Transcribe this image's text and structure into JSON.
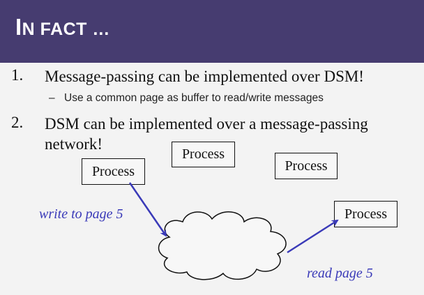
{
  "slide": {
    "title_first": "I",
    "title_rest": "N FACT …",
    "items": [
      {
        "number": "1.",
        "text": "Message-passing can be implemented over DSM!",
        "sub_dash": "–",
        "sub": "Use a common page as buffer to read/write messages"
      },
      {
        "number": "2.",
        "text": "DSM can be implemented over a message-passing network!"
      }
    ],
    "diagram": {
      "processes": [
        "Process",
        "Process",
        "Process",
        "Process"
      ],
      "write_label": "write to page 5",
      "read_label": "read page 5"
    }
  },
  "colors": {
    "header": "#463c70",
    "arrow": "#3a3ab8"
  }
}
